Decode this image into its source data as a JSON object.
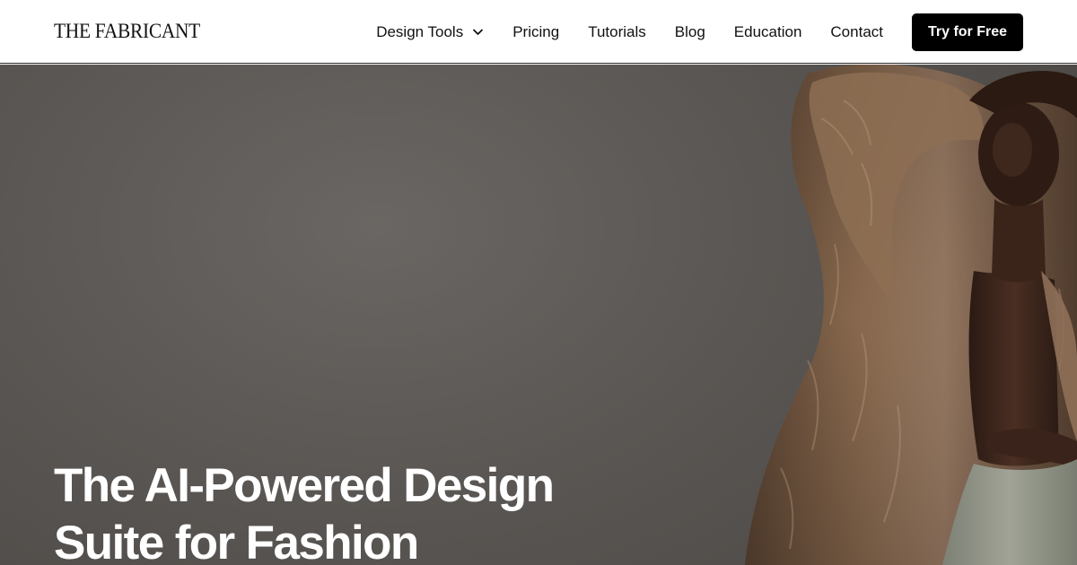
{
  "brand": {
    "logo_text": "THE FABRICANT"
  },
  "nav": {
    "items": [
      {
        "label": "Design Tools",
        "has_dropdown": true
      },
      {
        "label": "Pricing"
      },
      {
        "label": "Tutorials"
      },
      {
        "label": "Blog"
      },
      {
        "label": "Education"
      },
      {
        "label": "Contact"
      }
    ],
    "cta_label": "Try for Free"
  },
  "hero": {
    "headline_line1": "The AI-Powered Design",
    "headline_line2": "Suite for Fashion",
    "image_icon": "fashion-model-fur-coat-photo"
  },
  "colors": {
    "nav_bg": "#ffffff",
    "cta_bg": "#000000",
    "hero_bg": "#5b5754",
    "fur": "#7b5e45",
    "headline": "#ffffff"
  }
}
